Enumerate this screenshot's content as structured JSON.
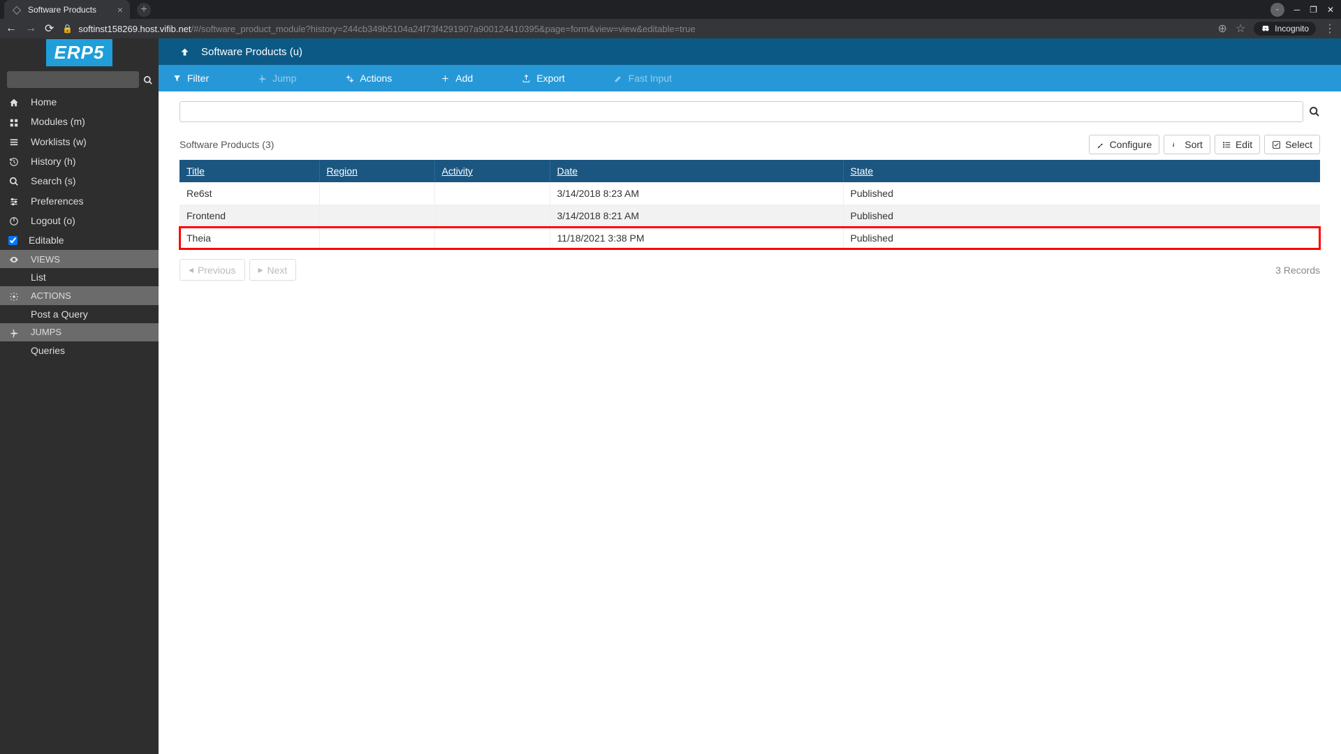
{
  "browser": {
    "tab_title": "Software Products",
    "url_host": "softinst158269.host.vifib.net",
    "url_path": "/#/software_product_module?history=244cb349b5104a24f73f4291907a900124410395&page=form&view=view&editable=true",
    "incognito": "Incognito"
  },
  "logo": "ERP5",
  "sidebar": {
    "items": [
      {
        "label": "Home"
      },
      {
        "label": "Modules (m)"
      },
      {
        "label": "Worklists (w)"
      },
      {
        "label": "History (h)"
      },
      {
        "label": "Search (s)"
      },
      {
        "label": "Preferences"
      },
      {
        "label": "Logout (o)"
      },
      {
        "label": "Editable"
      }
    ],
    "sections": {
      "views": "VIEWS",
      "views_list": "List",
      "actions": "ACTIONS",
      "actions_post": "Post a Query",
      "jumps": "JUMPS",
      "jumps_queries": "Queries"
    }
  },
  "breadcrumb": "Software Products (u)",
  "toolbar": {
    "filter": "Filter",
    "jump": "Jump",
    "actions": "Actions",
    "add": "Add",
    "export": "Export",
    "fast_input": "Fast Input"
  },
  "table": {
    "title": "Software Products (3)",
    "buttons": {
      "configure": "Configure",
      "sort": "Sort",
      "edit": "Edit",
      "select": "Select"
    },
    "columns": {
      "title": "Title",
      "region": "Region",
      "activity": "Activity",
      "date": "Date",
      "state": "State"
    },
    "rows": [
      {
        "title": "Re6st",
        "region": "",
        "activity": "",
        "date": "3/14/2018 8:23 AM",
        "state": "Published"
      },
      {
        "title": "Frontend",
        "region": "",
        "activity": "",
        "date": "3/14/2018 8:21 AM",
        "state": "Published"
      },
      {
        "title": "Theia",
        "region": "",
        "activity": "",
        "date": "11/18/2021 3:38 PM",
        "state": "Published"
      }
    ]
  },
  "pagination": {
    "previous": "Previous",
    "next": "Next",
    "records": "3 Records"
  }
}
